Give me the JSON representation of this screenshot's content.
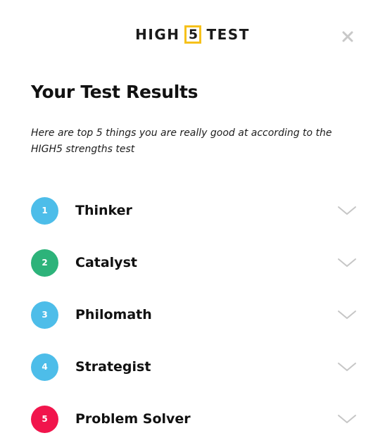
{
  "header": {
    "logo_left": "HIGH",
    "logo_number": "5",
    "logo_right": "TEST",
    "close_icon": "close-icon"
  },
  "title": "Your Test Results",
  "subtitle": "Here are top 5 things you are really good at according to the HIGH5 strengths test",
  "results": [
    {
      "number": "1",
      "label": "Thinker",
      "color": "#4dbde9",
      "icon": "chevron-down-icon"
    },
    {
      "number": "2",
      "label": "Catalyst",
      "color": "#2db37a",
      "icon": "chevron-down-icon"
    },
    {
      "number": "3",
      "label": "Philomath",
      "color": "#4dbde9",
      "icon": "chevron-down-icon"
    },
    {
      "number": "4",
      "label": "Strategist",
      "color": "#4dbde9",
      "icon": "chevron-down-icon"
    },
    {
      "number": "5",
      "label": "Problem Solver",
      "color": "#f1154c",
      "icon": "chevron-down-icon"
    }
  ],
  "colors": {
    "logo_accent": "#f6c11b",
    "chevron": "#c6c6c6",
    "close": "#c8c8c8"
  }
}
